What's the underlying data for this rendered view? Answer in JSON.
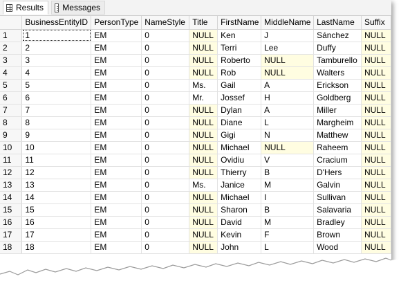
{
  "tabs": [
    {
      "label": "Results",
      "icon": "grid-icon",
      "active": true
    },
    {
      "label": "Messages",
      "icon": "messages-icon",
      "active": false
    }
  ],
  "columns": [
    "",
    "BusinessEntityID",
    "PersonType",
    "NameStyle",
    "Title",
    "FirstName",
    "MiddleName",
    "LastName",
    "Suffix"
  ],
  "rows": [
    [
      "1",
      "1",
      "EM",
      "0",
      "NULL",
      "Ken",
      "J",
      "Sánchez",
      "NULL"
    ],
    [
      "2",
      "2",
      "EM",
      "0",
      "NULL",
      "Terri",
      "Lee",
      "Duffy",
      "NULL"
    ],
    [
      "3",
      "3",
      "EM",
      "0",
      "NULL",
      "Roberto",
      "NULL",
      "Tamburello",
      "NULL"
    ],
    [
      "4",
      "4",
      "EM",
      "0",
      "NULL",
      "Rob",
      "NULL",
      "Walters",
      "NULL"
    ],
    [
      "5",
      "5",
      "EM",
      "0",
      "Ms.",
      "Gail",
      "A",
      "Erickson",
      "NULL"
    ],
    [
      "6",
      "6",
      "EM",
      "0",
      "Mr.",
      "Jossef",
      "H",
      "Goldberg",
      "NULL"
    ],
    [
      "7",
      "7",
      "EM",
      "0",
      "NULL",
      "Dylan",
      "A",
      "Miller",
      "NULL"
    ],
    [
      "8",
      "8",
      "EM",
      "0",
      "NULL",
      "Diane",
      "L",
      "Margheim",
      "NULL"
    ],
    [
      "9",
      "9",
      "EM",
      "0",
      "NULL",
      "Gigi",
      "N",
      "Matthew",
      "NULL"
    ],
    [
      "10",
      "10",
      "EM",
      "0",
      "NULL",
      "Michael",
      "NULL",
      "Raheem",
      "NULL"
    ],
    [
      "11",
      "11",
      "EM",
      "0",
      "NULL",
      "Ovidiu",
      "V",
      "Cracium",
      "NULL"
    ],
    [
      "12",
      "12",
      "EM",
      "0",
      "NULL",
      "Thierry",
      "B",
      "D'Hers",
      "NULL"
    ],
    [
      "13",
      "13",
      "EM",
      "0",
      "Ms.",
      "Janice",
      "M",
      "Galvin",
      "NULL"
    ],
    [
      "14",
      "14",
      "EM",
      "0",
      "NULL",
      "Michael",
      "I",
      "Sullivan",
      "NULL"
    ],
    [
      "15",
      "15",
      "EM",
      "0",
      "NULL",
      "Sharon",
      "B",
      "Salavaria",
      "NULL"
    ],
    [
      "16",
      "16",
      "EM",
      "0",
      "NULL",
      "David",
      "M",
      "Bradley",
      "NULL"
    ],
    [
      "17",
      "17",
      "EM",
      "0",
      "NULL",
      "Kevin",
      "F",
      "Brown",
      "NULL"
    ],
    [
      "18",
      "18",
      "EM",
      "0",
      "NULL",
      "John",
      "L",
      "Wood",
      "NULL"
    ]
  ],
  "null_highlight_color": "#fffde1"
}
